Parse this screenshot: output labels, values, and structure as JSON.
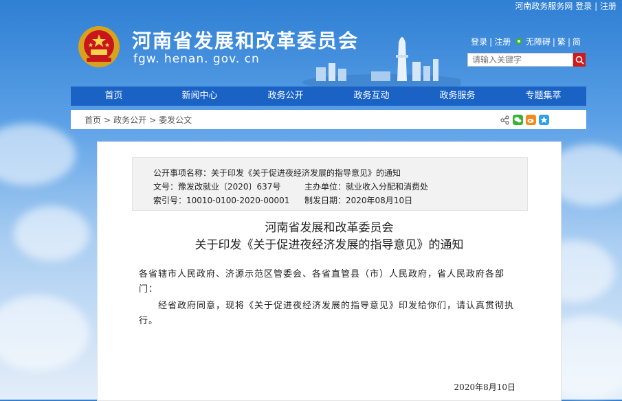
{
  "top_bar": {
    "site_name": "河南政务服务网",
    "login": "登录",
    "sep": "|",
    "register": "注册"
  },
  "header": {
    "title": "河南省发展和改革委员会",
    "domain": "fgw. henan. gov. cn",
    "links": {
      "login": "登录",
      "register": "注册",
      "accessible": "无障碍",
      "traditional": "繁",
      "simplified": "简",
      "sep": "|"
    },
    "search_placeholder": "请输入关键字"
  },
  "nav": {
    "items": [
      "首页",
      "新闻中心",
      "政务公开",
      "政务互动",
      "政务服务",
      "专题集萃"
    ]
  },
  "breadcrumb": {
    "items": [
      "首页",
      "政务公开",
      "委发公文"
    ],
    "sep": ">"
  },
  "meta": {
    "item_name": "公开事项名称：关于印发《关于促进夜经济发展的指导意见》的通知",
    "doc_no": "文号：豫发改就业〔2020〕637号",
    "host_unit": "主办单位：就业收入分配和消费处",
    "index_no": "索引号：10010-0100-2020-00001",
    "pub_date": "制发日期：2020年08月10日"
  },
  "document": {
    "title_line1": "河南省发展和改革委员会",
    "title_line2": "关于印发《关于促进夜经济发展的指导意见》的通知",
    "para1": "各省辖市人民政府、济源示范区管委会、各省直管县（市）人民政府，省人民政府各部门：",
    "para2": "经省政府同意，现将《关于促进夜经济发展的指导意见》印发给你们，请认真贯彻执行。",
    "date": "2020年8月10日"
  },
  "colors": {
    "nav_blue": "#1a63c5",
    "search_red": "#cf1b1b",
    "wechat_green": "#3cb034",
    "weibo_orange": "#f08c1e",
    "qzone_blue": "#2ea3e3"
  }
}
